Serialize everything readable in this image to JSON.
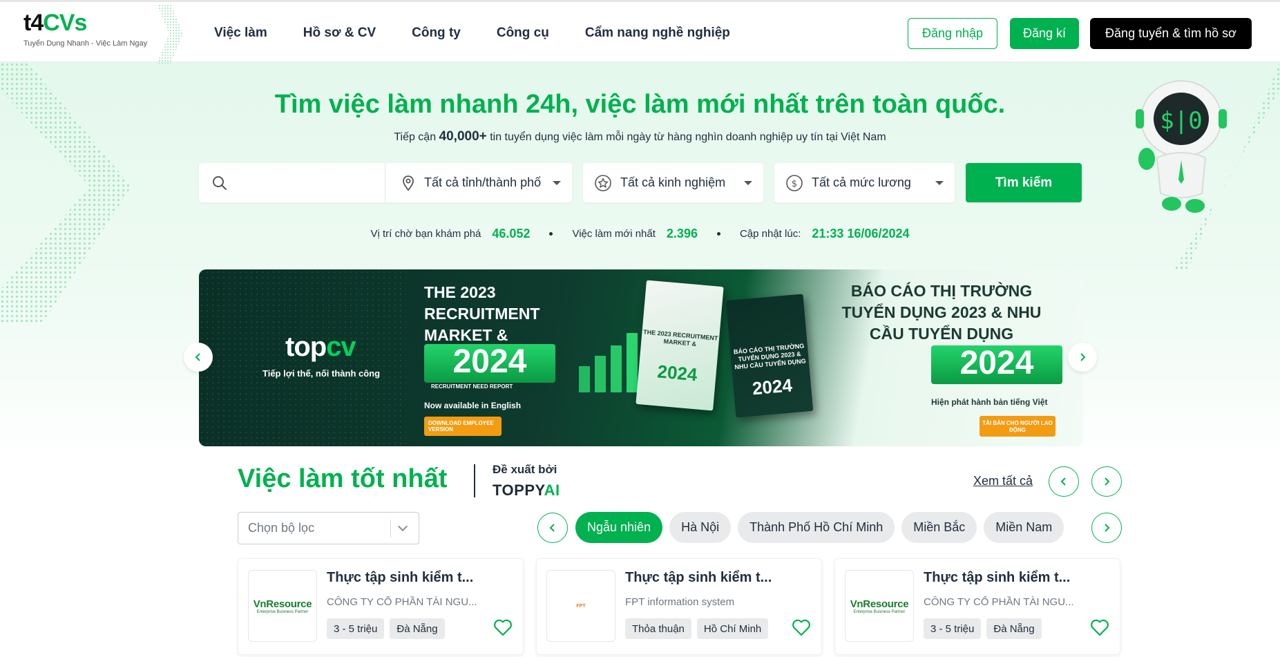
{
  "header": {
    "logo_main_prefix": "t4",
    "logo_main_cv": "CVs",
    "logo_sub": "Tuyển Dụng Nhanh - Việc Làm Ngay",
    "nav": [
      "Việc làm",
      "Hồ sơ & CV",
      "Công ty",
      "Công cụ",
      "Cẩm nang nghề nghiệp"
    ],
    "login_label": "Đăng nhập",
    "register_label": "Đăng kí",
    "employer_label": "Đăng tuyển & tìm hồ sơ"
  },
  "hero": {
    "title": "Tìm việc làm nhanh 24h, việc làm mới nhất trên toàn quốc.",
    "sub_prefix": "Tiếp cận ",
    "sub_count": "40,000+",
    "sub_suffix": " tin tuyển dụng việc làm mỗi ngày từ hàng nghìn doanh nghiệp uy tín tại Việt Nam",
    "search_placeholder": "",
    "location_select": "Tất cả tỉnh/thành phố",
    "experience_select": "Tất cả kinh nghiệm",
    "salary_select": "Tất cả mức lương",
    "search_button": "Tìm kiếm",
    "stats": {
      "positions_label": "Vị trí chờ bạn khám phá",
      "positions_value": "46.052",
      "newest_label": "Việc làm mới nhất",
      "newest_value": "2.396",
      "updated_label": "Cập nhật lúc:",
      "updated_value": "21:33 16/06/2024"
    }
  },
  "banner": {
    "logo_top": "top",
    "logo_cv": "cv",
    "tagline": "Tiếp lợi thế, nối thành công",
    "heading_en": "THE 2023 RECRUITMENT MARKET &",
    "year": "2024",
    "report_en": "RECRUITMENT NEED REPORT",
    "available_en": "Now available in English",
    "download_en": "DOWNLOAD EMPLOYEE VERSION",
    "book1_text": "THE 2023 RECRUITMENT MARKET &",
    "book2_text": "BÁO CÁO THỊ TRƯỜNG TUYỂN DỤNG 2023 & NHU CẦU TUYỂN DỤNG",
    "heading_vi": "BÁO CÁO THỊ TRƯỜNG TUYỂN DỤNG 2023 & NHU CẦU TUYỂN DỤNG",
    "available_vi": "Hiện phát hành bản tiếng Việt",
    "download_vi": "TẢI BẢN CHO NGƯỜI LAO ĐỘNG"
  },
  "section": {
    "title": "Việc làm tốt nhất",
    "suggested_by": "Đề xuất bởi",
    "ai_prefix": "TOPPY",
    "ai_suffix": "AI",
    "see_all": "Xem tất cả",
    "filter_placeholder": "Chọn bộ lọc",
    "chips": [
      "Ngẫu nhiên",
      "Hà Nội",
      "Thành Phố Hồ Chí Minh",
      "Miền Bắc",
      "Miền Nam"
    ],
    "active_chip": "Ngẫu nhiên"
  },
  "jobs": [
    {
      "title": "Thực tập sinh kiểm t...",
      "company": "CÔNG TY CỔ PHẦN TÀI NGU...",
      "salary": "3 - 5 triệu",
      "location": "Đà Nẵng",
      "logo_text": "VnResource",
      "logo_sub": "Enterprise Business Partner"
    },
    {
      "title": "Thực tập sinh kiểm t...",
      "company": "FPT information system",
      "salary": "Thỏa thuận",
      "location": "Hồ Chí Minh",
      "logo_text": "FPT",
      "logo_sub": ""
    },
    {
      "title": "Thực tập sinh kiểm t...",
      "company": "CÔNG TY CỔ PHẦN TÀI NGU...",
      "salary": "3 - 5 triệu",
      "location": "Đà Nẵng",
      "logo_text": "VnResource",
      "logo_sub": "Enterprise Business Partner"
    }
  ],
  "colors": {
    "brand": "#00b14f",
    "text": "#212f3f",
    "muted": "#6f7882"
  },
  "icons": [
    "search-icon",
    "location-pin-icon",
    "star-icon",
    "dollar-icon",
    "chevron-left-icon",
    "chevron-right-icon",
    "heart-icon",
    "robot-mascot"
  ]
}
